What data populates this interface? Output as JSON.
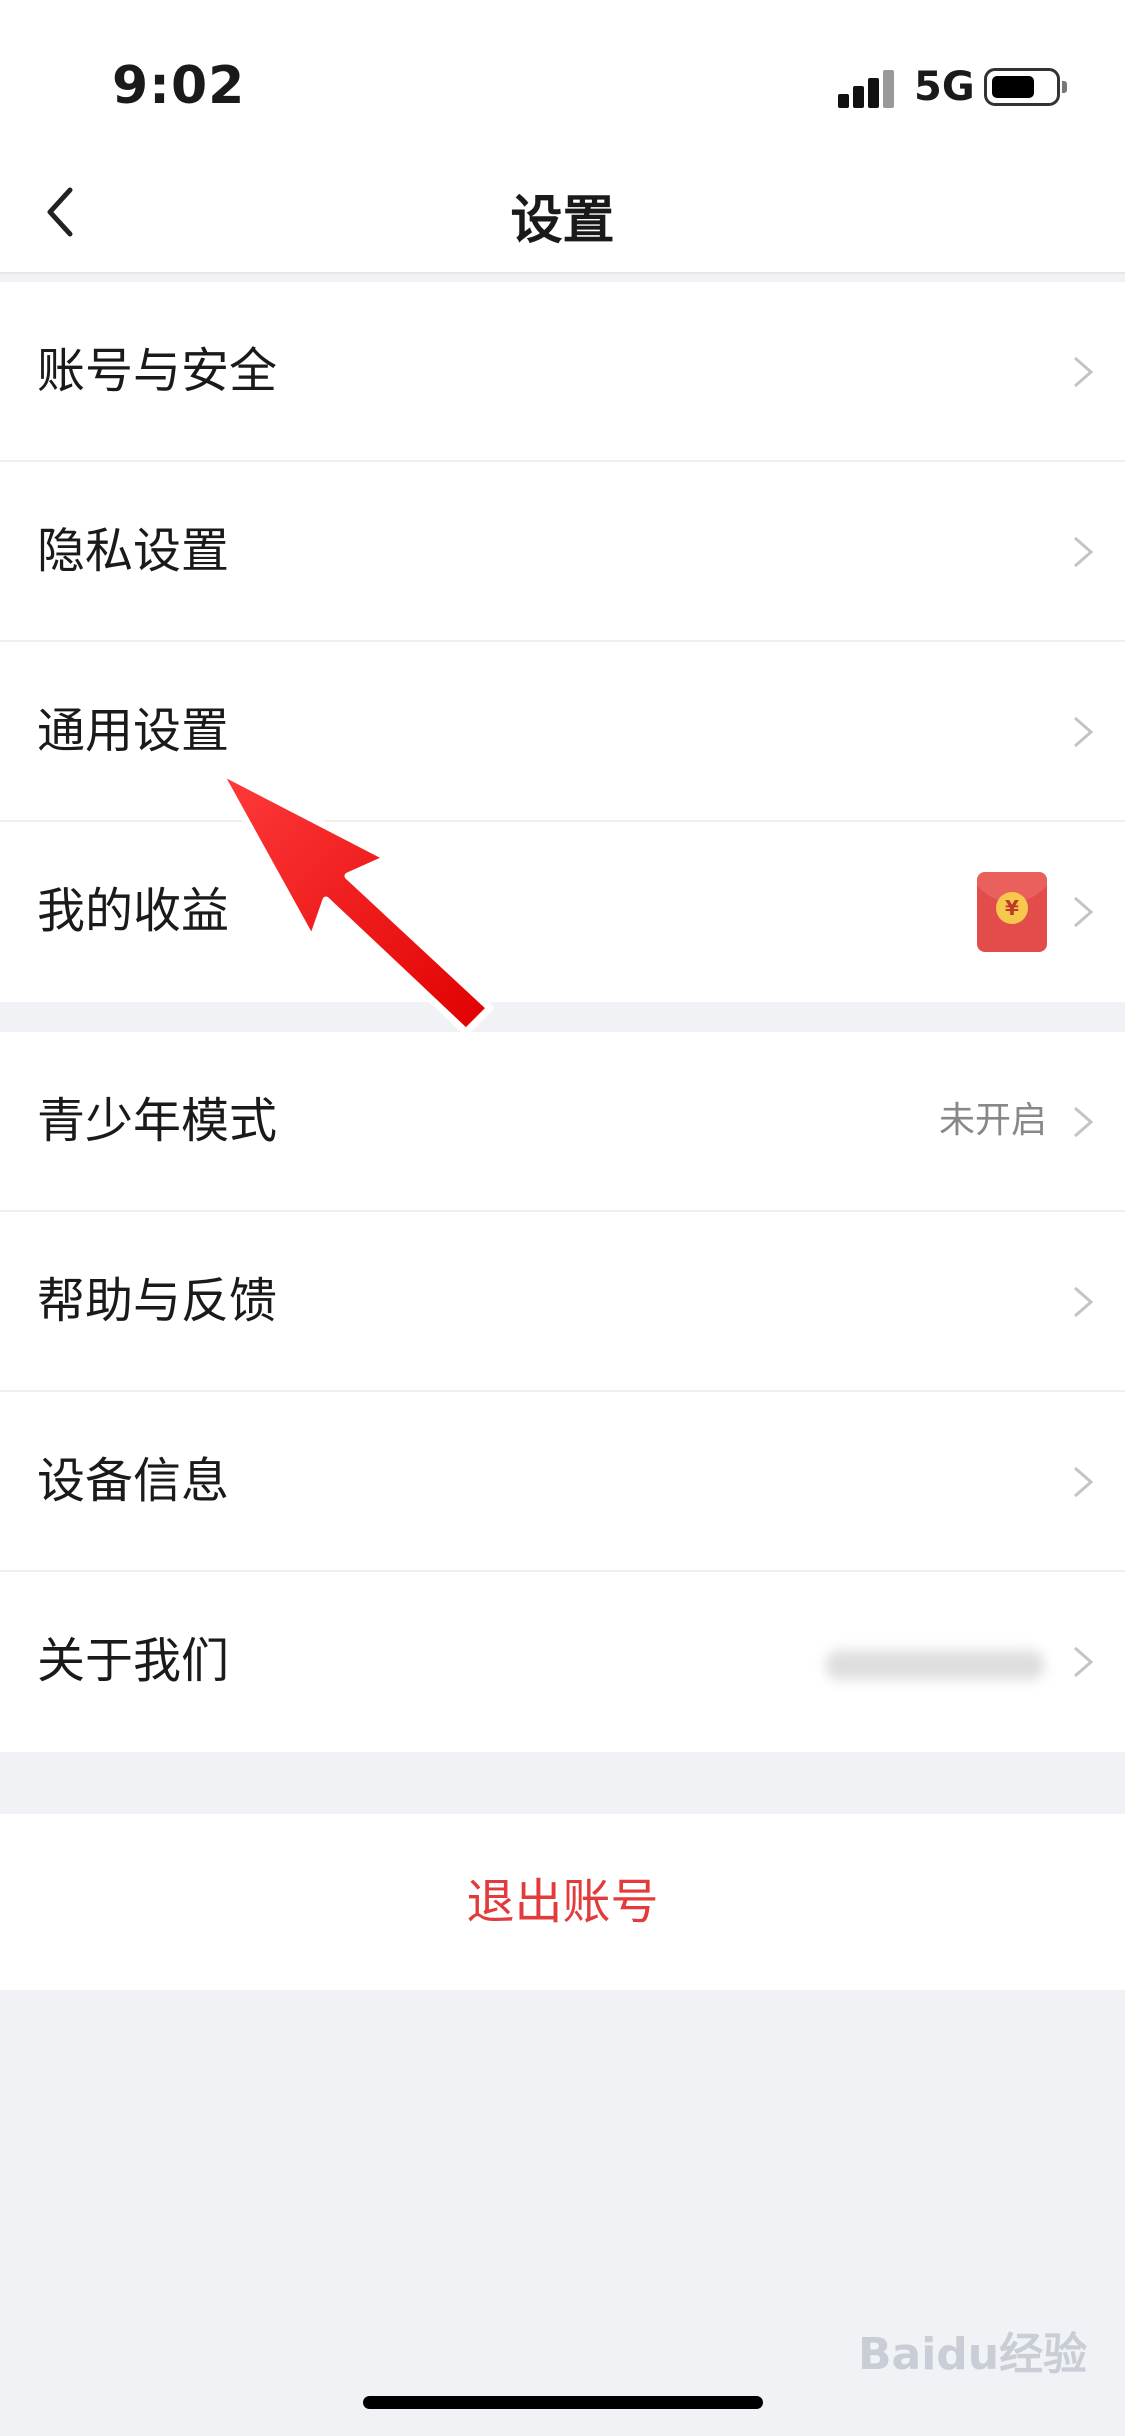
{
  "status_bar": {
    "time": "9:02",
    "network": "5G"
  },
  "nav": {
    "title": "设置"
  },
  "groups": [
    {
      "items": [
        {
          "label": "账号与安全"
        },
        {
          "label": "隐私设置"
        },
        {
          "label": "通用设置"
        },
        {
          "label": "我的收益",
          "badge": "¥"
        }
      ]
    },
    {
      "items": [
        {
          "label": "青少年模式",
          "value": "未开启"
        },
        {
          "label": "帮助与反馈"
        },
        {
          "label": "设备信息"
        },
        {
          "label": "关于我们"
        }
      ]
    }
  ],
  "logout_label": "退出账号",
  "watermark": "Baidu经验",
  "colors": {
    "logout": "#e33b3b",
    "arrow": "#ff1a1a",
    "background": "#f0f2f5"
  }
}
